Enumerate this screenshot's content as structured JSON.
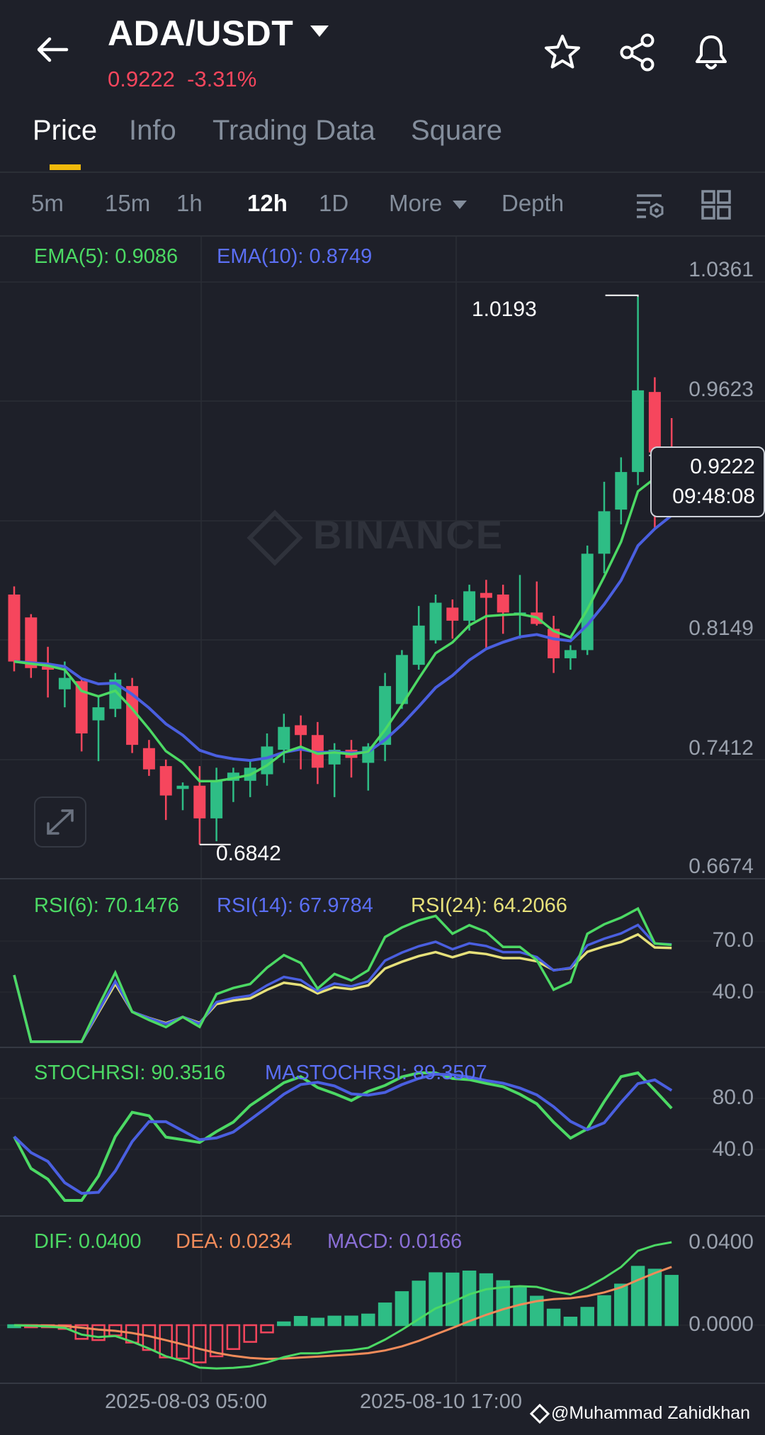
{
  "header": {
    "pair": "ADA/USDT",
    "last_price": "0.9222",
    "change": "-3.31%",
    "icons": [
      "back-arrow-icon",
      "star-icon",
      "share-icon",
      "bell-icon"
    ]
  },
  "tabs": [
    {
      "label": "Price",
      "active": true
    },
    {
      "label": "Info"
    },
    {
      "label": "Trading Data"
    },
    {
      "label": "Square"
    }
  ],
  "intervals": [
    {
      "label": "5m"
    },
    {
      "label": "15m"
    },
    {
      "label": "1h"
    },
    {
      "label": "12h",
      "active": true
    },
    {
      "label": "1D"
    },
    {
      "label": "More"
    },
    {
      "label": "Depth"
    }
  ],
  "main_panel": {
    "ema5_label": "EMA(5): 0.9086",
    "ema10_label": "EMA(10): 0.8749",
    "axis_labels": [
      "1.0361",
      "0.9623",
      "0.8149",
      "0.7412",
      "0.6674"
    ],
    "high_marker": "1.0193",
    "low_marker": "0.6842",
    "current_price": "0.9222",
    "countdown": "09:48:08",
    "watermark": "BINANCE"
  },
  "rsi_panel": {
    "rsi6": "RSI(6): 70.1476",
    "rsi14": "RSI(14): 67.9784",
    "rsi24": "RSI(24): 64.2066",
    "axis_labels": [
      "70.0",
      "40.0"
    ]
  },
  "stoch_panel": {
    "stoch": "STOCHRSI: 90.3516",
    "mastoch": "MASTOCHRSI: 89.3507",
    "axis_labels": [
      "80.0",
      "40.0"
    ]
  },
  "macd_panel": {
    "dif": "DIF: 0.0400",
    "dea": "DEA: 0.0234",
    "macd": "MACD: 0.0166",
    "axis_labels": [
      "0.0400",
      "0.0000"
    ]
  },
  "date_labels": [
    "2025-08-03 05:00",
    "2025-08-10 17:00"
  ],
  "credit": "@Muhammad Zahidkhan",
  "colors": {
    "up": "#2ebd85",
    "down": "#f6465d",
    "ema5": "#4cd964",
    "ema10": "#4a5fe0",
    "accent": "#f0b90b"
  },
  "chart_data": {
    "type": "candlestick",
    "ylim": [
      0.6674,
      1.0361
    ],
    "candles": [
      [
        0.837,
        0.842,
        0.79,
        0.796
      ],
      [
        0.823,
        0.825,
        0.786,
        0.792
      ],
      [
        0.793,
        0.805,
        0.774,
        0.791
      ],
      [
        0.779,
        0.796,
        0.768,
        0.786
      ],
      [
        0.784,
        0.786,
        0.741,
        0.752
      ],
      [
        0.76,
        0.775,
        0.735,
        0.768
      ],
      [
        0.767,
        0.789,
        0.762,
        0.785
      ],
      [
        0.781,
        0.786,
        0.74,
        0.745
      ],
      [
        0.743,
        0.748,
        0.726,
        0.73
      ],
      [
        0.732,
        0.736,
        0.699,
        0.714
      ],
      [
        0.718,
        0.722,
        0.705,
        0.72
      ],
      [
        0.72,
        0.732,
        0.684,
        0.7
      ],
      [
        0.7,
        0.731,
        0.686,
        0.723
      ],
      [
        0.723,
        0.731,
        0.71,
        0.728
      ],
      [
        0.723,
        0.735,
        0.713,
        0.731
      ],
      [
        0.727,
        0.752,
        0.72,
        0.744
      ],
      [
        0.742,
        0.764,
        0.734,
        0.756
      ],
      [
        0.757,
        0.763,
        0.73,
        0.751
      ],
      [
        0.751,
        0.759,
        0.721,
        0.731
      ],
      [
        0.733,
        0.746,
        0.713,
        0.742
      ],
      [
        0.742,
        0.748,
        0.725,
        0.737
      ],
      [
        0.734,
        0.746,
        0.717,
        0.744
      ],
      [
        0.745,
        0.789,
        0.735,
        0.781
      ],
      [
        0.77,
        0.803,
        0.767,
        0.8
      ],
      [
        0.794,
        0.83,
        0.791,
        0.818
      ],
      [
        0.809,
        0.837,
        0.807,
        0.832
      ],
      [
        0.829,
        0.834,
        0.81,
        0.821
      ],
      [
        0.821,
        0.843,
        0.815,
        0.839
      ],
      [
        0.838,
        0.846,
        0.804,
        0.835
      ],
      [
        0.837,
        0.843,
        0.813,
        0.826
      ],
      [
        0.826,
        0.849,
        0.81,
        0.826
      ],
      [
        0.826,
        0.845,
        0.818,
        0.819
      ],
      [
        0.816,
        0.824,
        0.789,
        0.798
      ],
      [
        0.798,
        0.806,
        0.791,
        0.803
      ],
      [
        0.803,
        0.867,
        0.8,
        0.862
      ],
      [
        0.862,
        0.906,
        0.85,
        0.888
      ],
      [
        0.889,
        0.921,
        0.88,
        0.912
      ],
      [
        0.912,
        1.0193,
        0.904,
        0.962
      ],
      [
        0.961,
        0.97,
        0.877,
        0.924
      ],
      [
        0.924,
        0.945,
        0.91,
        0.9222
      ]
    ]
  }
}
